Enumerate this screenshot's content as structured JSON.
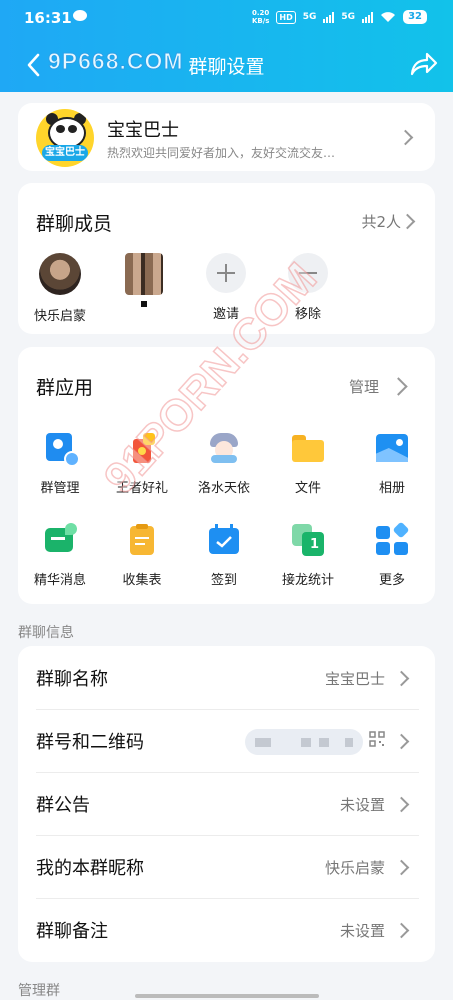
{
  "status_bar": {
    "time": "16:31",
    "net_speed": "0.20\nKB/s",
    "hd": "HD",
    "net1": "5G",
    "net2": "5G",
    "battery": "32"
  },
  "nav": {
    "title": "群聊设置"
  },
  "watermarks": {
    "top": "9P668.COM",
    "diagonal": "91PORN.COM"
  },
  "group": {
    "name": "宝宝巴士",
    "description": "热烈欢迎共同爱好者加入，友好交流交友…",
    "avatar_badge": "宝宝巴士"
  },
  "members": {
    "title": "群聊成员",
    "count": "共2人",
    "items": [
      {
        "label": "快乐启蒙"
      },
      {
        "label": ""
      },
      {
        "label": "邀请"
      },
      {
        "label": "移除"
      }
    ]
  },
  "apps": {
    "title": "群应用",
    "manage": "管理",
    "items": [
      {
        "label": "群管理",
        "icon": "group-manage-icon"
      },
      {
        "label": "王者好礼",
        "icon": "gift-icon"
      },
      {
        "label": "洛水天依",
        "icon": "character-icon"
      },
      {
        "label": "文件",
        "icon": "folder-icon"
      },
      {
        "label": "相册",
        "icon": "album-icon"
      },
      {
        "label": "精华消息",
        "icon": "essence-message-icon"
      },
      {
        "label": "收集表",
        "icon": "form-icon"
      },
      {
        "label": "签到",
        "icon": "checkin-icon"
      },
      {
        "label": "接龙统计",
        "icon": "relay-icon"
      },
      {
        "label": "更多",
        "icon": "more-grid-icon"
      }
    ]
  },
  "info": {
    "section_label": "群聊信息",
    "rows": [
      {
        "title": "群聊名称",
        "value": "宝宝巴士"
      },
      {
        "title": "群号和二维码",
        "value": ""
      },
      {
        "title": "群公告",
        "value": "未设置"
      },
      {
        "title": "我的本群昵称",
        "value": "快乐启蒙"
      },
      {
        "title": "群聊备注",
        "value": "未设置"
      }
    ]
  },
  "manage_section_label": "管理群",
  "colors": {
    "header_start": "#1fa8f5",
    "header_end": "#12c2ea",
    "accent": "#1aa8e8"
  }
}
